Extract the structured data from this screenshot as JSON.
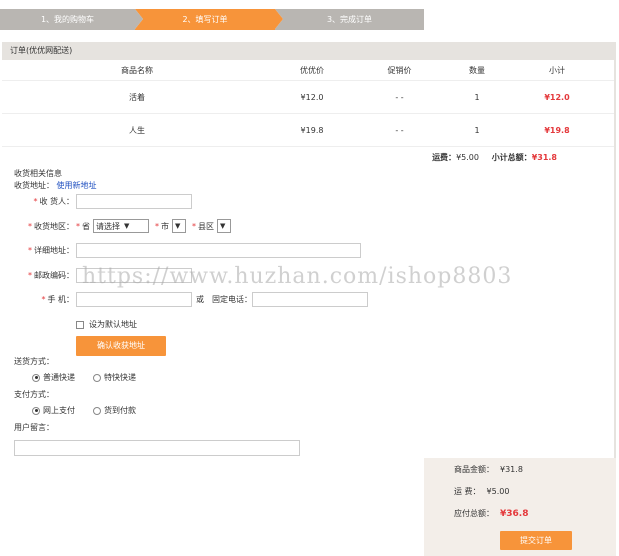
{
  "steps": [
    "1、我的购物车",
    "2、填写订单",
    "3、完成订单"
  ],
  "order_title": "订单(优优网配送)",
  "table": {
    "headers": [
      "商品名称",
      "优优价",
      "促销价",
      "数量",
      "小计"
    ],
    "rows": [
      {
        "name": "活着",
        "price": "¥12.0",
        "promo": "- -",
        "qty": "1",
        "subtotal": "¥12.0"
      },
      {
        "name": "人生",
        "price": "¥19.8",
        "promo": "- -",
        "qty": "1",
        "subtotal": "¥19.8"
      }
    ]
  },
  "totals": {
    "shipping_label": "运费：",
    "shipping": "¥5.00",
    "subtotal_label": "小计总额：",
    "subtotal": "¥31.8"
  },
  "form": {
    "section_title": "收货相关信息",
    "address_label": "收货地址：",
    "new_address_link": "使用新地址",
    "receiver_label": "收  货人：",
    "region_label": "收货地区：",
    "province_label": "省",
    "province_value": "请选择",
    "city_label": "市",
    "district_label": "县区",
    "detail_label": "详细地址：",
    "zip_label": "邮政编码：",
    "phone_label": "手    机：",
    "or_label": "或",
    "tel_label": "固定电话：",
    "default_checkbox": "设为默认地址",
    "confirm_button": "确认收获地址"
  },
  "delivery": {
    "label": "送货方式：",
    "options": [
      "普通快递",
      "特快快递"
    ],
    "selected": 0
  },
  "payment": {
    "label": "支付方式：",
    "options": [
      "网上支付",
      "货到付款"
    ],
    "selected": 0
  },
  "remark_label": "用户留言：",
  "summary": {
    "goods_label": "商品金额：",
    "goods": "¥31.8",
    "freight_label": "运      费：",
    "freight": "¥5.00",
    "total_label": "应付总额：",
    "total": "¥36.8",
    "submit": "提交订单"
  },
  "watermark": "https://www.huzhan.com/ishop8803",
  "colors": {
    "accent": "#f7943a",
    "price_red": "#e4393c",
    "step_gray": "#b9b6b2"
  }
}
